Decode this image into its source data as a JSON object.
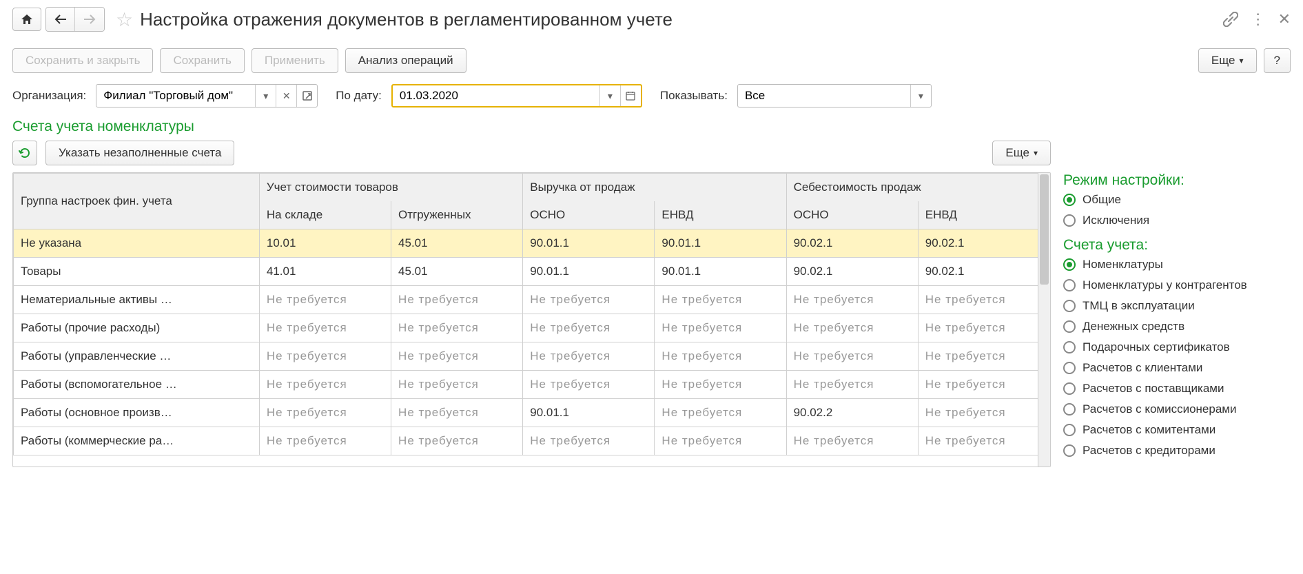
{
  "header": {
    "title": "Настройка отражения документов в регламентированном учете"
  },
  "commands": {
    "save_close": "Сохранить и закрыть",
    "save": "Сохранить",
    "apply": "Применить",
    "analyze": "Анализ операций",
    "more": "Еще",
    "help": "?"
  },
  "filters": {
    "org_label": "Организация:",
    "org_value": "Филиал \"Торговый дом\"",
    "date_label": "По дату:",
    "date_value": "01.03.2020",
    "show_label": "Показывать:",
    "show_value": "Все"
  },
  "section": {
    "title": "Счета учета номенклатуры",
    "fill_empty": "Указать незаполненные счета",
    "more": "Еще"
  },
  "table": {
    "headers": {
      "group": "Группа настроек фин. учета",
      "cost": "Учет стоимости товаров",
      "revenue": "Выручка от продаж",
      "cogs": "Себестоимость продаж",
      "in_stock": "На складе",
      "shipped": "Отгруженных",
      "osno": "ОСНО",
      "envd": "ЕНВД"
    },
    "not_required": "Не требуется",
    "rows": [
      {
        "name": "Не указана",
        "selected": true,
        "vals": [
          "10.01",
          "45.01",
          "90.01.1",
          "90.01.1",
          "90.02.1",
          "90.02.1"
        ]
      },
      {
        "name": "Товары",
        "selected": false,
        "vals": [
          "41.01",
          "45.01",
          "90.01.1",
          "90.01.1",
          "90.02.1",
          "90.02.1"
        ]
      },
      {
        "name": "Нематериальные активы …",
        "selected": false,
        "vals": [
          null,
          null,
          null,
          null,
          null,
          null
        ]
      },
      {
        "name": "Работы (прочие расходы)",
        "selected": false,
        "vals": [
          null,
          null,
          null,
          null,
          null,
          null
        ]
      },
      {
        "name": "Работы (управленческие …",
        "selected": false,
        "vals": [
          null,
          null,
          null,
          null,
          null,
          null
        ]
      },
      {
        "name": "Работы (вспомогательное …",
        "selected": false,
        "vals": [
          null,
          null,
          null,
          null,
          null,
          null
        ]
      },
      {
        "name": "Работы (основное произв…",
        "selected": false,
        "vals": [
          null,
          null,
          "90.01.1",
          null,
          "90.02.2",
          null
        ]
      },
      {
        "name": "Работы (коммерческие ра…",
        "selected": false,
        "vals": [
          null,
          null,
          null,
          null,
          null,
          null
        ]
      }
    ]
  },
  "sidebar": {
    "mode_title": "Режим настройки:",
    "modes": [
      {
        "label": "Общие",
        "checked": true
      },
      {
        "label": "Исключения",
        "checked": false
      }
    ],
    "accounts_title": "Счета учета:",
    "accounts": [
      {
        "label": "Номенклатуры",
        "checked": true
      },
      {
        "label": "Номенклатуры у контрагентов",
        "checked": false
      },
      {
        "label": "ТМЦ в эксплуатации",
        "checked": false
      },
      {
        "label": "Денежных средств",
        "checked": false
      },
      {
        "label": "Подарочных сертификатов",
        "checked": false
      },
      {
        "label": "Расчетов с клиентами",
        "checked": false
      },
      {
        "label": "Расчетов с поставщиками",
        "checked": false
      },
      {
        "label": "Расчетов с комиссионерами",
        "checked": false
      },
      {
        "label": "Расчетов с комитентами",
        "checked": false
      },
      {
        "label": "Расчетов с кредиторами",
        "checked": false
      }
    ]
  }
}
